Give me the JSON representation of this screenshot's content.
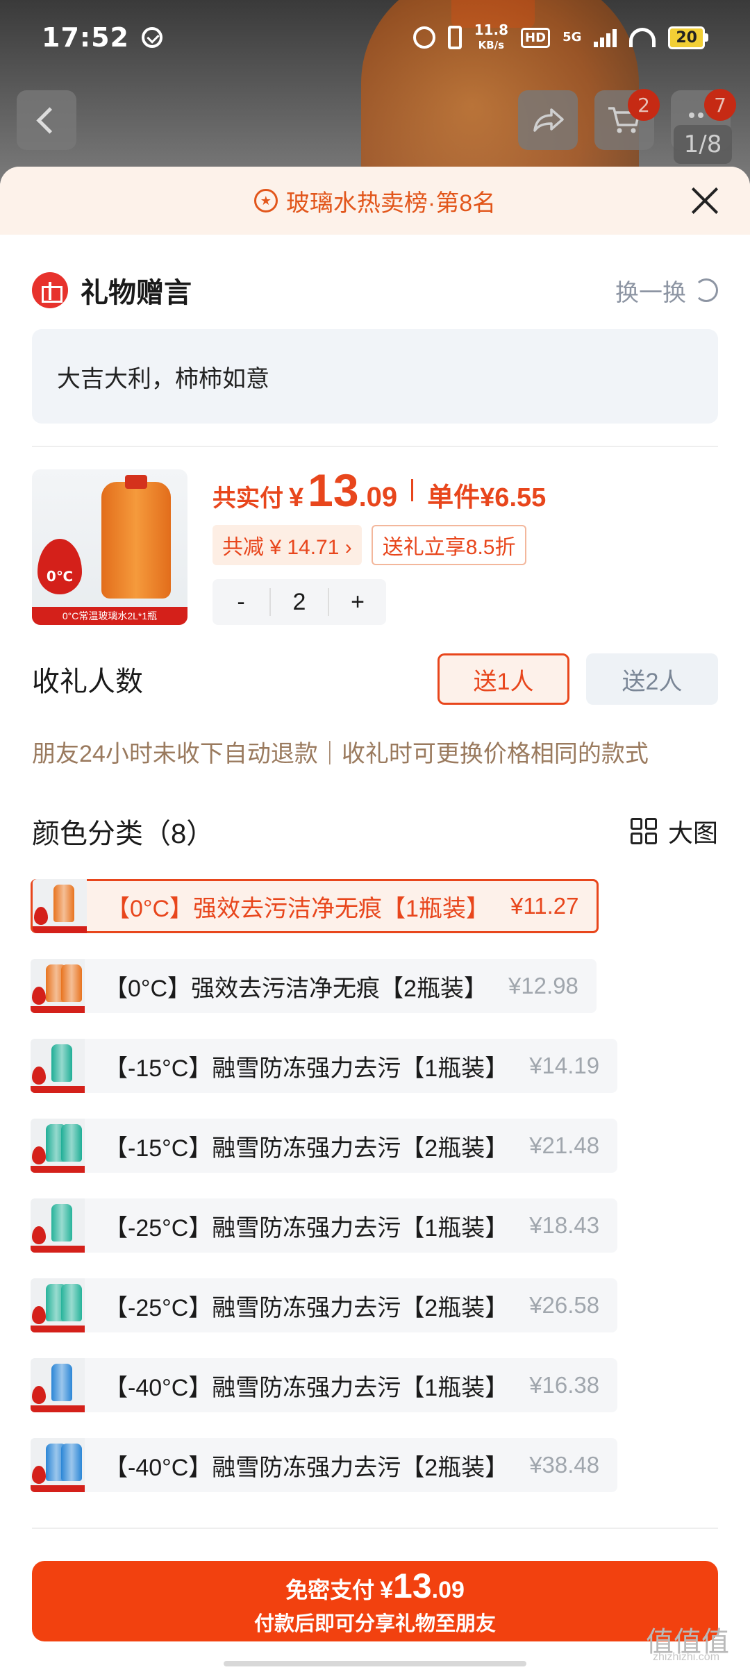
{
  "status_bar": {
    "time": "17:52",
    "net_speed_value": "11.8",
    "net_speed_unit": "KB/s",
    "hd": "HD",
    "network": "5G",
    "battery": "20"
  },
  "nav": {
    "cart_badge": "2",
    "more_badge": "7",
    "image_index": "1/8"
  },
  "rank_banner": {
    "text": "玻璃水热卖榜·第8名"
  },
  "gift_message": {
    "title": "礼物赠言",
    "refresh_label": "换一换",
    "message": "大吉大利，柿柿如意"
  },
  "product": {
    "image_caption": "0°C常温玻璃水2L*1瓶",
    "image_badge": "0℃",
    "total_label": "共实付",
    "currency": "¥",
    "total_int": "13",
    "total_dec": ".09",
    "unit_price": "单件¥6.55",
    "savings_tag": "共减 ¥ 14.71 ›",
    "discount_tag": "送礼立享8.5折",
    "qty_minus": "-",
    "quantity": "2",
    "qty_plus": "+"
  },
  "recipients": {
    "title": "收礼人数",
    "options": [
      "送1人",
      "送2人"
    ],
    "selected": 0
  },
  "notice": "朋友24小时未收下自动退款｜收礼时可更换价格相同的款式",
  "variants_section": {
    "title": "颜色分类（8）",
    "big_view_label": "大图"
  },
  "variants": [
    {
      "name": "【0°C】强效去污洁净无痕【1瓶装】",
      "price": "¥11.27",
      "color": "#e8741f",
      "bottles": 1
    },
    {
      "name": "【0°C】强效去污洁净无痕【2瓶装】",
      "price": "¥12.98",
      "color": "#e8741f",
      "bottles": 2
    },
    {
      "name": "【-15°C】融雪防冻强力去污【1瓶装】",
      "price": "¥14.19",
      "color": "#1fae96",
      "bottles": 1
    },
    {
      "name": "【-15°C】融雪防冻强力去污【2瓶装】",
      "price": "¥21.48",
      "color": "#1fae96",
      "bottles": 2
    },
    {
      "name": "【-25°C】融雪防冻强力去污【1瓶装】",
      "price": "¥18.43",
      "color": "#26b39a",
      "bottles": 1
    },
    {
      "name": "【-25°C】融雪防冻强力去污【2瓶装】",
      "price": "¥26.58",
      "color": "#26b39a",
      "bottles": 2
    },
    {
      "name": "【-40°C】融雪防冻强力去污【1瓶装】",
      "price": "¥16.38",
      "color": "#2b86d6",
      "bottles": 1
    },
    {
      "name": "【-40°C】融雪防冻强力去污【2瓶装】",
      "price": "¥38.48",
      "color": "#2b86d6",
      "bottles": 2
    }
  ],
  "selected_variant": 0,
  "pay_button": {
    "label": "免密支付",
    "currency": "¥",
    "amount_int": "13",
    "amount_dec": ".09",
    "sub": "付款后即可分享礼物至朋友"
  },
  "watermark": {
    "text": "值值值",
    "sub": "zhizhizhi.com"
  },
  "colors": {
    "accent": "#e8461c",
    "pay": "#f2410f",
    "rank_bg": "#fdf2ea"
  }
}
